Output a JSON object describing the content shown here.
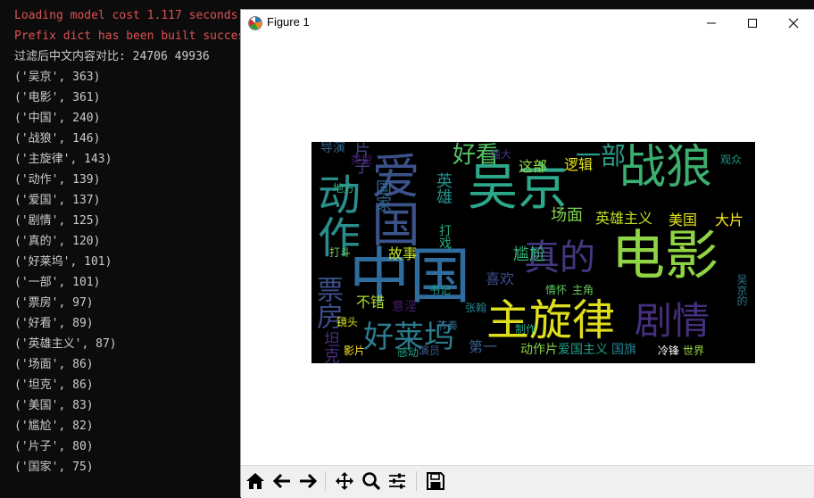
{
  "console": {
    "lines": [
      {
        "text": "Loading model cost 1.117 seconds.",
        "color": "#e05252"
      },
      {
        "text": "Prefix dict has been built successfully.",
        "color": "#e05252"
      },
      {
        "text": "过滤后中文内容对比: 24706 49936",
        "color": "#cccccc"
      },
      {
        "text": "('吴京', 363)",
        "color": "#cccccc"
      },
      {
        "text": "('电影', 361)",
        "color": "#cccccc"
      },
      {
        "text": "('中国', 240)",
        "color": "#cccccc"
      },
      {
        "text": "('战狼', 146)",
        "color": "#cccccc"
      },
      {
        "text": "('主旋律', 143)",
        "color": "#cccccc"
      },
      {
        "text": "('动作', 139)",
        "color": "#cccccc"
      },
      {
        "text": "('爱国', 137)",
        "color": "#cccccc"
      },
      {
        "text": "('剧情', 125)",
        "color": "#cccccc"
      },
      {
        "text": "('真的', 120)",
        "color": "#cccccc"
      },
      {
        "text": "('好莱坞', 101)",
        "color": "#cccccc"
      },
      {
        "text": "('一部', 101)",
        "color": "#cccccc"
      },
      {
        "text": "('票房', 97)",
        "color": "#cccccc"
      },
      {
        "text": "('好看', 89)",
        "color": "#cccccc"
      },
      {
        "text": "('英雄主义', 87)",
        "color": "#cccccc"
      },
      {
        "text": "('场面', 86)",
        "color": "#cccccc"
      },
      {
        "text": "('坦克', 86)",
        "color": "#cccccc"
      },
      {
        "text": "('美国', 83)",
        "color": "#cccccc"
      },
      {
        "text": "('尴尬', 82)",
        "color": "#cccccc"
      },
      {
        "text": "('片子', 80)",
        "color": "#cccccc"
      },
      {
        "text": "('国家', 75)",
        "color": "#cccccc"
      }
    ]
  },
  "figure_window": {
    "title": "Figure 1",
    "controls": {
      "minimize_icon": "minimize-icon",
      "maximize_icon": "maximize-icon",
      "close_icon": "close-icon"
    },
    "toolbar": [
      "home-icon",
      "back-arrow-icon",
      "forward-arrow-icon",
      "pan-icon",
      "zoom-icon",
      "configure-subplots-icon",
      "save-icon"
    ]
  },
  "wordcloud": {
    "words": [
      {
        "text": "战狼",
        "color": "#3cae6f"
      },
      {
        "text": "吴京",
        "color": "#2ea88a"
      },
      {
        "text": "电影",
        "color": "#8fd444"
      },
      {
        "text": "中国",
        "color": "#2e6d9d"
      },
      {
        "text": "主旋律",
        "color": "#dede1a"
      },
      {
        "text": "动作",
        "color": "#2b8d8c"
      },
      {
        "text": "爱国",
        "color": "#3b528b"
      },
      {
        "text": "剧情",
        "color": "#46307e"
      },
      {
        "text": "真的",
        "color": "#453882"
      },
      {
        "text": "好莱坞",
        "color": "#2c7c8e"
      },
      {
        "text": "一部",
        "color": "#2d9b8a"
      },
      {
        "text": "票房",
        "color": "#3d4e8a"
      },
      {
        "text": "好看",
        "color": "#55c667"
      },
      {
        "text": "英雄主义",
        "color": "#c0df25"
      },
      {
        "text": "场面",
        "color": "#7fd34e"
      },
      {
        "text": "坦克",
        "color": "#472d7b"
      },
      {
        "text": "美国",
        "color": "#e0e31b"
      },
      {
        "text": "尴尬",
        "color": "#35b779"
      },
      {
        "text": "片子",
        "color": "#414487"
      },
      {
        "text": "国家",
        "color": "#31688e"
      },
      {
        "text": "大片",
        "color": "#fde725"
      },
      {
        "text": "故事",
        "color": "#c5e021"
      },
      {
        "text": "这部",
        "color": "#93d741"
      },
      {
        "text": "逻辑",
        "color": "#e3e418"
      },
      {
        "text": "不错",
        "color": "#b2dd2d"
      },
      {
        "text": "喜欢",
        "color": "#3e4c8a"
      },
      {
        "text": "动作片",
        "color": "#86d549"
      },
      {
        "text": "爱国主义",
        "color": "#1fa187"
      },
      {
        "text": "国旗",
        "color": "#26818e"
      },
      {
        "text": "英雄",
        "color": "#20928c"
      },
      {
        "text": "第一",
        "color": "#34618d"
      },
      {
        "text": "导演",
        "color": "#31688e"
      },
      {
        "text": "类型",
        "color": "#482173"
      },
      {
        "text": "地方",
        "color": "#30b57b"
      },
      {
        "text": "打斗",
        "color": "#73d055"
      },
      {
        "text": "打戏",
        "color": "#25ac82"
      },
      {
        "text": "意淫",
        "color": "#481b6d"
      },
      {
        "text": "冷锋",
        "color": "#ffffff"
      },
      {
        "text": "书记",
        "color": "#1f9e89"
      },
      {
        "text": "主角",
        "color": "#6ccd5a"
      },
      {
        "text": "情怀",
        "color": "#5ec962"
      },
      {
        "text": "张翰",
        "color": "#25848e"
      },
      {
        "text": "制作",
        "color": "#22a785"
      },
      {
        "text": "影片",
        "color": "#fde725"
      },
      {
        "text": "演员",
        "color": "#38598c"
      },
      {
        "text": "吴京的",
        "color": "#2a788e"
      },
      {
        "text": "世界",
        "color": "#9bd93c"
      },
      {
        "text": "强大",
        "color": "#443a83"
      },
      {
        "text": "观众",
        "color": "#1e9b8a"
      },
      {
        "text": "节奏",
        "color": "#31678e"
      },
      {
        "text": "感动",
        "color": "#20a386"
      },
      {
        "text": "镜头",
        "color": "#d5e21a"
      }
    ]
  }
}
